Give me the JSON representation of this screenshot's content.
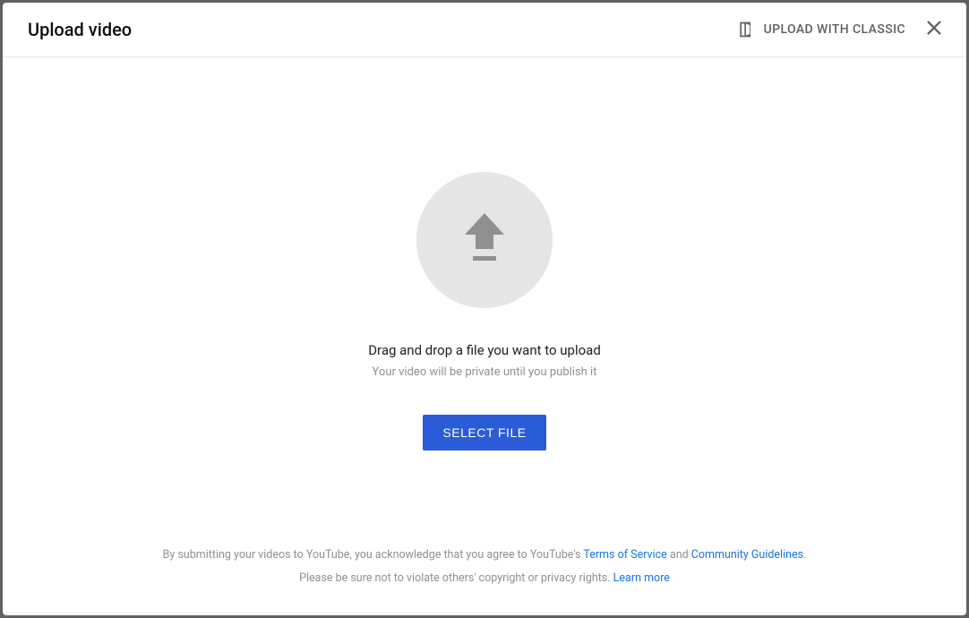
{
  "header": {
    "title": "Upload video",
    "classic_label": "UPLOAD WITH CLASSIC"
  },
  "upload": {
    "drag_text": "Drag and drop a file you want to upload",
    "privacy_text": "Your video will be private until you publish it",
    "select_button": "SELECT FILE"
  },
  "footer": {
    "line1_prefix": "By submitting your videos to YouTube, you acknowledge that you agree to YouTube's ",
    "tos_link": "Terms of Service",
    "line1_and": " and ",
    "guidelines_link": "Community Guidelines",
    "line1_suffix": ".",
    "line2_prefix": "Please be sure not to violate others' copyright or privacy rights. ",
    "learn_more_link": "Learn more"
  }
}
